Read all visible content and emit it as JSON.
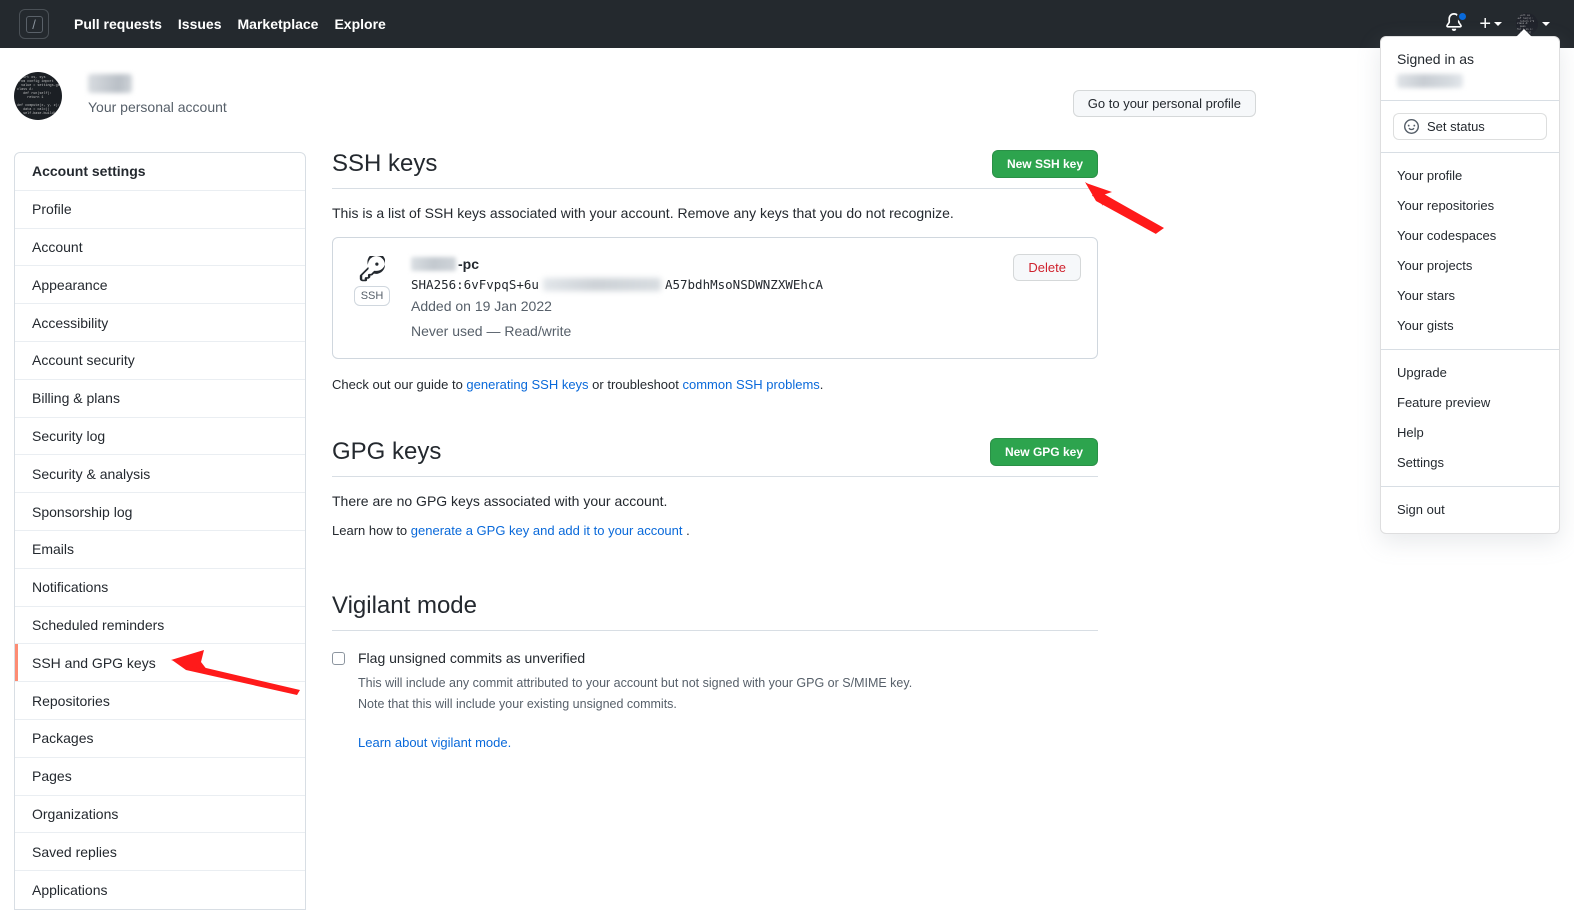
{
  "header": {
    "search_shortcut": "/",
    "nav": [
      {
        "label": "Pull requests"
      },
      {
        "label": "Issues"
      },
      {
        "label": "Marketplace"
      },
      {
        "label": "Explore"
      }
    ],
    "icons": {
      "notifications": "bell-icon",
      "create_new": "plus-icon",
      "account": "avatar-icon"
    }
  },
  "profile": {
    "account_label": "Your personal account",
    "go_to_profile_button": "Go to your personal profile"
  },
  "sidebar": {
    "heading": "Account settings",
    "items": [
      {
        "label": "Profile",
        "active": false
      },
      {
        "label": "Account",
        "active": false
      },
      {
        "label": "Appearance",
        "active": false
      },
      {
        "label": "Accessibility",
        "active": false
      },
      {
        "label": "Account security",
        "active": false
      },
      {
        "label": "Billing & plans",
        "active": false
      },
      {
        "label": "Security log",
        "active": false
      },
      {
        "label": "Security & analysis",
        "active": false
      },
      {
        "label": "Sponsorship log",
        "active": false
      },
      {
        "label": "Emails",
        "active": false
      },
      {
        "label": "Notifications",
        "active": false
      },
      {
        "label": "Scheduled reminders",
        "active": false
      },
      {
        "label": "SSH and GPG keys",
        "active": true
      },
      {
        "label": "Repositories",
        "active": false
      },
      {
        "label": "Packages",
        "active": false
      },
      {
        "label": "Pages",
        "active": false
      },
      {
        "label": "Organizations",
        "active": false
      },
      {
        "label": "Saved replies",
        "active": false
      },
      {
        "label": "Applications",
        "active": false
      }
    ]
  },
  "ssh_section": {
    "title": "SSH keys",
    "new_button": "New SSH key",
    "description": "This is a list of SSH keys associated with your account. Remove any keys that you do not recognize.",
    "key": {
      "badge": "SSH",
      "name_suffix": "-pc",
      "fingerprint_prefix": "SHA256:6vFvpqS+6u",
      "fingerprint_suffix": "A57bdhMsoNSDWNZXWEhcA",
      "added": "Added on 19 Jan 2022",
      "usage": "Never used — Read/write",
      "delete_button": "Delete"
    },
    "note_prefix": "Check out our guide to ",
    "note_link1": "generating SSH keys",
    "note_middle": " or troubleshoot ",
    "note_link2": "common SSH problems",
    "note_suffix": "."
  },
  "gpg_section": {
    "title": "GPG keys",
    "new_button": "New GPG key",
    "empty_text": "There are no GPG keys associated with your account.",
    "learn_prefix": "Learn how to ",
    "learn_link": "generate a GPG key and add it to your account",
    "learn_suffix": " ."
  },
  "vigilant_section": {
    "title": "Vigilant mode",
    "checkbox_label": "Flag unsigned commits as unverified",
    "checkbox_checked": false,
    "sub_line1": "This will include any commit attributed to your account but not signed with your GPG or S/MIME key.",
    "sub_line2": "Note that this will include your existing unsigned commits.",
    "learn_link": "Learn about vigilant mode."
  },
  "dropdown": {
    "signed_in_as": "Signed in as",
    "set_status": "Set status",
    "group1": [
      {
        "label": "Your profile"
      },
      {
        "label": "Your repositories"
      },
      {
        "label": "Your codespaces"
      },
      {
        "label": "Your projects"
      },
      {
        "label": "Your stars"
      },
      {
        "label": "Your gists"
      }
    ],
    "group2": [
      {
        "label": "Upgrade"
      },
      {
        "label": "Feature preview"
      },
      {
        "label": "Help"
      },
      {
        "label": "Settings"
      }
    ],
    "group3": [
      {
        "label": "Sign out"
      }
    ]
  },
  "colors": {
    "header_bg": "#24292e",
    "green_button": "#2da44e",
    "link_blue": "#0969da",
    "danger_red": "#cf222e",
    "active_border": "#fd8c73",
    "annotation_arrow": "#ff1a1a"
  },
  "annotations": [
    {
      "name": "arrow-to-new-ssh-key",
      "color": "#ff1a1a"
    },
    {
      "name": "arrow-to-ssh-gpg-keys-nav",
      "color": "#ff1a1a"
    }
  ]
}
